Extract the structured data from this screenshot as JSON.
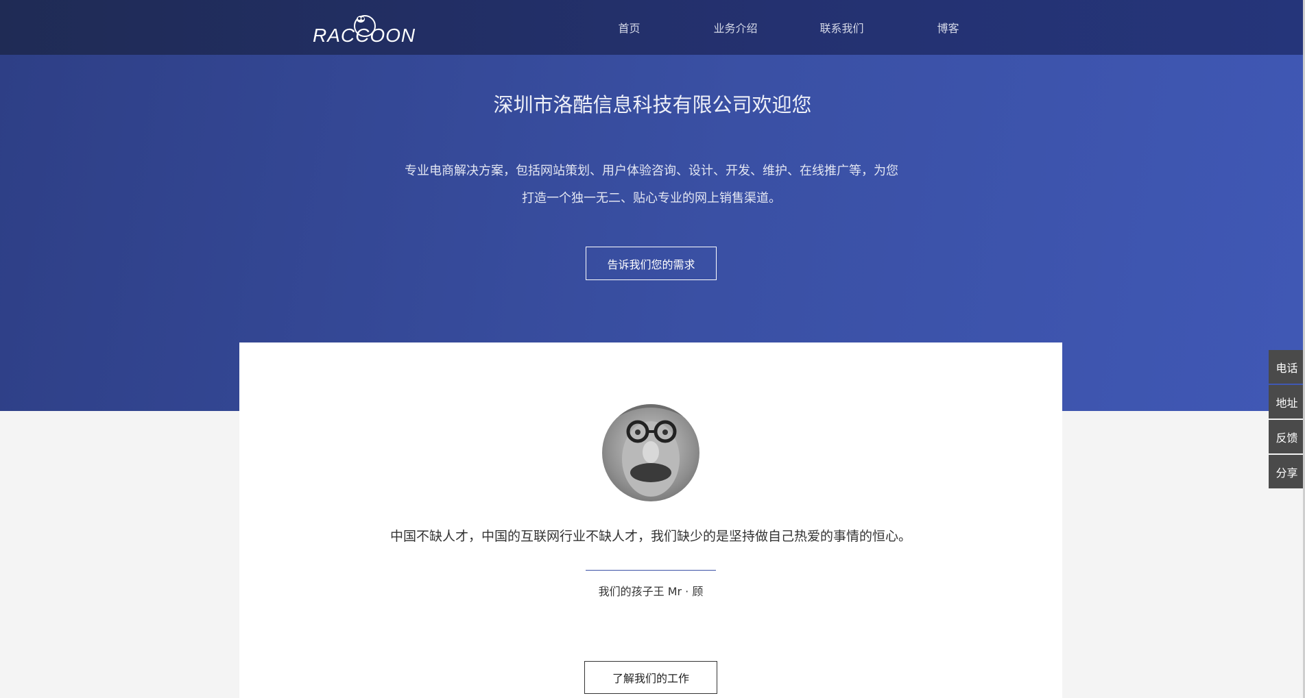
{
  "header": {
    "logo_text": "RACCOON",
    "nav": [
      {
        "label": "首页"
      },
      {
        "label": "业务介绍"
      },
      {
        "label": "联系我们"
      },
      {
        "label": "博客"
      }
    ]
  },
  "hero": {
    "title": "深圳市洛酷信息科技有限公司欢迎您",
    "description_line1": "专业电商解决方案，包括网站策划、用户体验咨询、设计、开发、维护、在线推广等，为您",
    "description_line2": "打造一个独一无二、贴心专业的网上销售渠道。",
    "cta_label": "告诉我们您的需求"
  },
  "testimonial": {
    "quote": "中国不缺人才，中国的互联网行业不缺人才，我们缺少的是坚持做自己热爱的事情的恒心。",
    "author": "我们的孩子王 Mr · 顾",
    "cta_label": "了解我们的工作"
  },
  "side_tools": [
    {
      "label": "电话"
    },
    {
      "label": "地址"
    },
    {
      "label": "反馈"
    },
    {
      "label": "分享"
    }
  ],
  "colors": {
    "header_bg": "#1f2b55",
    "hero_bg": "#3a50a4",
    "accent": "#3a50a4",
    "side_tool_bg": "#4a4a4a"
  }
}
